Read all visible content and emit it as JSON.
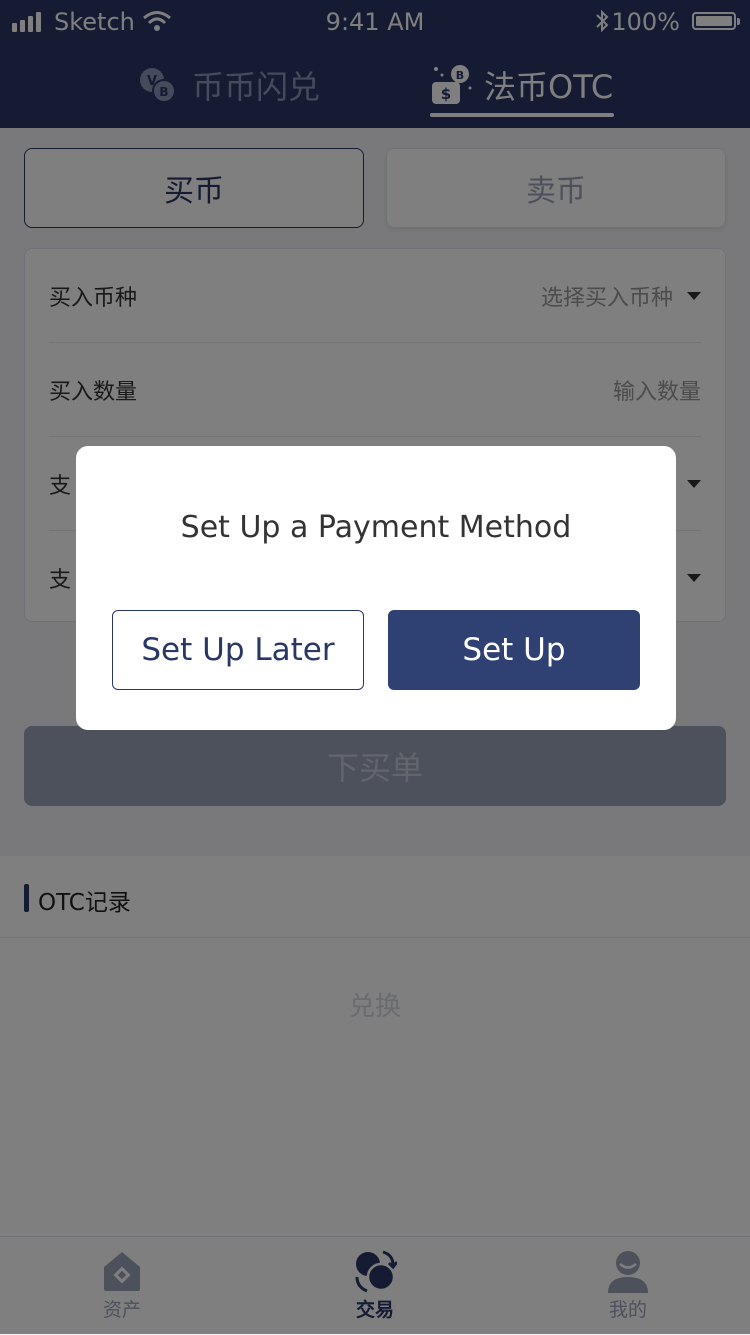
{
  "status_bar": {
    "carrier": "Sketch",
    "time": "9:41 AM",
    "battery": "100%"
  },
  "header": {
    "tabs": [
      {
        "label": "币币闪兑"
      },
      {
        "label": "法币OTC"
      }
    ]
  },
  "trade_mode": {
    "buy": "买币",
    "sell": "卖币"
  },
  "form": {
    "rows": [
      {
        "label": "买入币种",
        "value": "选择买入币种"
      },
      {
        "label": "买入数量",
        "value": "输入数量"
      },
      {
        "label": "支",
        "value": ""
      },
      {
        "label": "支",
        "value": ""
      }
    ],
    "submit": "下买单"
  },
  "records": {
    "title": "OTC记录",
    "empty_text": "兑换"
  },
  "tabbar": {
    "items": [
      {
        "label": "资产"
      },
      {
        "label": "交易"
      },
      {
        "label": "我的"
      }
    ]
  },
  "dialog": {
    "title": "Set Up a Payment Method",
    "later": "Set Up Later",
    "setup": "Set Up"
  },
  "colors": {
    "navy": "#283766",
    "button_navy": "#2f4173"
  }
}
